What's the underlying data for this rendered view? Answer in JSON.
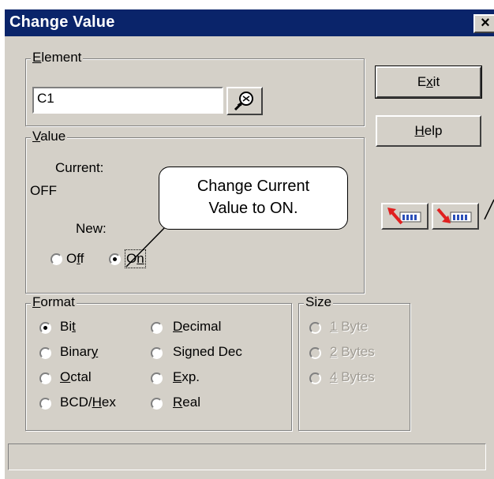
{
  "window": {
    "title": "Change Value",
    "close_label": "×"
  },
  "element": {
    "group_label_key": "E",
    "group_label_rest": "lement",
    "value": "C1",
    "lookup_icon": "magnifier-icon"
  },
  "value_group": {
    "label_key": "V",
    "label_rest": "alue",
    "current_label": "Current:",
    "current_value": "OFF",
    "new_label": "New:",
    "off_pre": "O",
    "off_key": "f",
    "off_post": "f",
    "on_pre": "O",
    "on_key": "n",
    "selected": "On"
  },
  "buttons": {
    "exit_pre": "E",
    "exit_key": "x",
    "exit_post": "it",
    "help_key": "H",
    "help_post": "elp",
    "toolbar_left_icon": "read-from-plc-icon",
    "toolbar_right_icon": "write-to-plc-icon"
  },
  "format": {
    "label_key": "F",
    "label_rest": "ormat",
    "selected": "Bit",
    "options": {
      "bit_pre": "Bi",
      "bit_key": "t",
      "binary_pre": "Binar",
      "binary_key": "y",
      "octal_key": "O",
      "octal_post": "ctal",
      "bcd_pre": "BCD/",
      "bcd_key": "H",
      "bcd_post": "ex",
      "decimal_key": "D",
      "decimal_post": "ecimal",
      "signed": "Signed Dec",
      "exp_key": "E",
      "exp_post": "xp.",
      "real_key": "R",
      "real_post": "eal"
    }
  },
  "size": {
    "label": "Size",
    "one_key": "1",
    "one_post": " Byte",
    "two_key": "2",
    "two_post": " Bytes",
    "four_key": "4",
    "four_post": " Bytes"
  },
  "callout": {
    "line1": "Change Current",
    "line2": "Value to ON."
  },
  "colors": {
    "titlebar": "#0a246a",
    "face": "#d4d0c8",
    "arrow": "#e02020",
    "icon_blue": "#2b4fb8"
  }
}
